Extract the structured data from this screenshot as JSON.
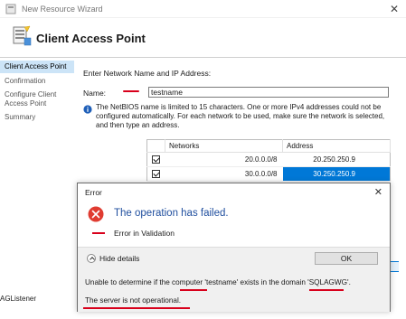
{
  "wizard": {
    "window_title": "New Resource Wizard",
    "close_glyph": "✕",
    "page_title": "Client Access Point",
    "nav": [
      {
        "label": "Client Access Point",
        "active": true
      },
      {
        "label": "Confirmation",
        "active": false
      },
      {
        "label": "Configure Client Access Point",
        "active": false
      },
      {
        "label": "Summary",
        "active": false
      }
    ],
    "prompt": "Enter Network Name and IP Address:",
    "name_label": "Name:",
    "name_value": "testname",
    "info_text": "The NetBIOS name is limited to 15 characters.  One or more IPv4 addresses could not be configured automatically.  For each network to be used, make sure the network is selected, and then type an address.",
    "table": {
      "headers": [
        "Networks",
        "Address"
      ],
      "rows": [
        {
          "checked": true,
          "network": "20.0.0.0/8",
          "address": "20.250.250.9",
          "selected": false
        },
        {
          "checked": true,
          "network": "30.0.0.0/8",
          "address": "30.250.250.9",
          "selected": true
        }
      ]
    },
    "bottom_text": "AGListener"
  },
  "error_dialog": {
    "title": "Error",
    "close_glyph": "✕",
    "main_message": "The operation has failed.",
    "sub_message": "Error in Validation",
    "hide_details_label": "Hide details",
    "ok_label": "OK",
    "detail_line1": "Unable to determine if the computer 'testname' exists in the domain 'SQLAGWG'.",
    "detail_line2": "The server is not operational."
  },
  "colors": {
    "accent_blue": "#0078d7",
    "selection_light": "#cce4f7",
    "error_red": "#e03c31",
    "heading_blue": "#1f4e9e",
    "ink_red": "#d8001b"
  },
  "icons": [
    "wizard-app-icon",
    "client-access-point-icon",
    "info-icon",
    "error-icon",
    "chevron-up-icon",
    "close-icon",
    "checkbox-checked-icon"
  ]
}
